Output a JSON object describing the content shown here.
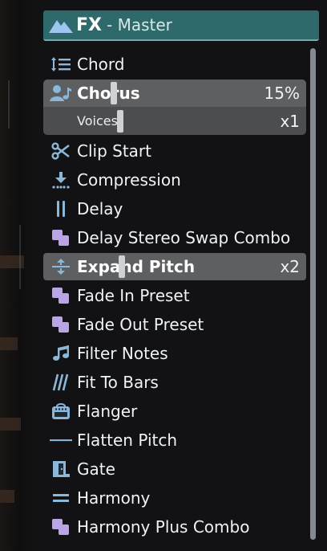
{
  "header": {
    "title": "FX",
    "subtitle": "- Master"
  },
  "items": [
    {
      "label": "Chord",
      "icon": "line-height-icon"
    },
    {
      "label": "Chorus",
      "icon": "user-music-icon",
      "value": "15%",
      "sub_label": "Voices",
      "sub_value": "x1",
      "active": true
    },
    {
      "label": "Clip Start",
      "icon": "scissors-icon"
    },
    {
      "label": "Compression",
      "icon": "compress-download-icon"
    },
    {
      "label": "Delay",
      "icon": "pause-bars-icon"
    },
    {
      "label": "Delay Stereo Swap Combo",
      "icon": "combo-squares-icon"
    },
    {
      "label": "Expand Pitch",
      "icon": "expand-arrows-icon",
      "value": "x2",
      "active": true
    },
    {
      "label": "Fade In Preset",
      "icon": "combo-squares-icon"
    },
    {
      "label": "Fade Out Preset",
      "icon": "combo-squares-icon"
    },
    {
      "label": "Filter Notes",
      "icon": "music-note-icon"
    },
    {
      "label": "Fit To Bars",
      "icon": "slash-bars-icon"
    },
    {
      "label": "Flanger",
      "icon": "amp-icon"
    },
    {
      "label": "Flatten Pitch",
      "icon": "flat-line-icon"
    },
    {
      "label": "Gate",
      "icon": "door-icon"
    },
    {
      "label": "Harmony",
      "icon": "equals-icon"
    },
    {
      "label": "Harmony Plus Combo",
      "icon": "combo-squares-icon"
    }
  ],
  "colors": {
    "header_bg": "#2e6a6b",
    "icon_blue": "#8bb7d8",
    "icon_purple": "#b9a4e6",
    "active_bg": "#5d5f61"
  }
}
